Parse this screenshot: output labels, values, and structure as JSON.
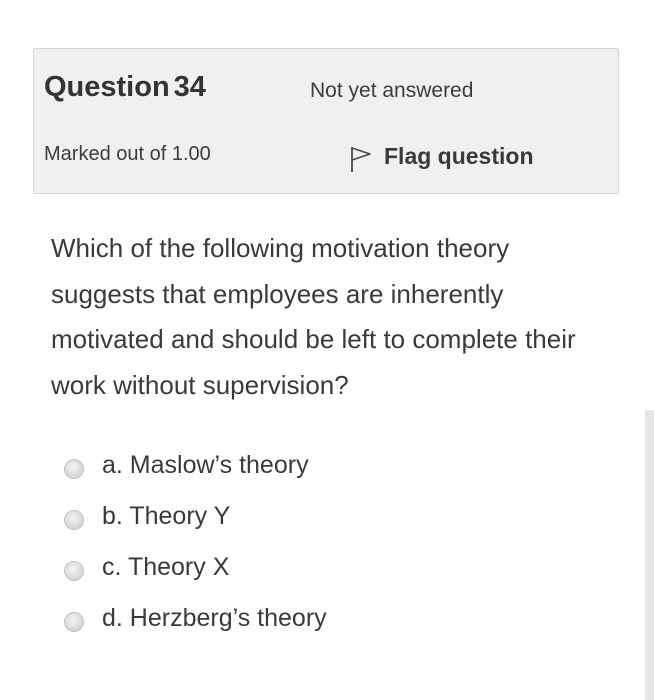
{
  "info": {
    "question_word": "Question",
    "question_number": "34",
    "state": "Not yet answered",
    "grade": "Marked out of 1.00",
    "flag_label": "Flag question",
    "flag_icon": "flag-outline-icon"
  },
  "question": {
    "text": "Which of the following motivation theory suggests that employees are inherently motivated and should be left to complete their work without supervision?"
  },
  "answers": [
    {
      "label": "a. Maslow’s theory"
    },
    {
      "label": "b. Theory Y"
    },
    {
      "label": "c. Theory X"
    },
    {
      "label": "d. Herzberg’s theory"
    }
  ],
  "colors": {
    "info_background": "#f0f0f0",
    "text": "#3a3a3a"
  }
}
